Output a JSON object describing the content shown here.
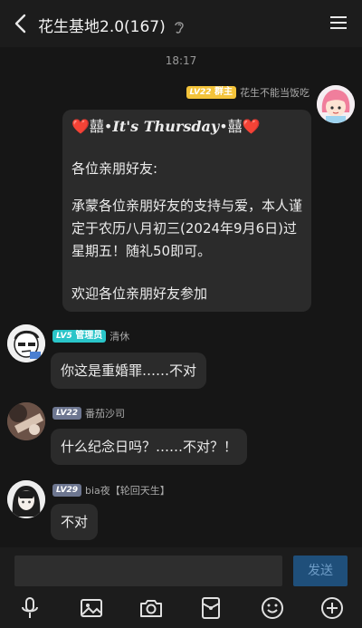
{
  "header": {
    "title": "花生基地2.0(167)"
  },
  "chat": {
    "timestamp": "18:17",
    "messages": [
      {
        "sender": "花生不能当饭吃",
        "level": "LV22",
        "role": "群主",
        "lines": {
          "greeting_pre": "❤️囍•",
          "greeting_mid": "It's Thursday",
          "greeting_post": "•囍❤️",
          "p2": "各位亲朋好友:",
          "p3": "承蒙各位亲朋好友的支持与爱，本人谨定于农历八月初三(2024年9月6日)过星期五！随礼50即可。",
          "p4": "欢迎各位亲朋好友参加"
        }
      },
      {
        "sender": "清休",
        "level": "LV5",
        "role": "管理员",
        "text": "你这是重婚罪……不对"
      },
      {
        "sender": "番茄沙司",
        "level": "LV22",
        "text": "什么纪念日吗？……不对？！"
      },
      {
        "sender": "bia夜【轮回天生】",
        "level": "LV29",
        "text": "不对"
      }
    ]
  },
  "input": {
    "placeholder": "",
    "send_label": "发送"
  },
  "colors": {
    "background": "#161616",
    "bubble": "#2b2b2b",
    "owner_tag": "#f3c33a",
    "admin_tag": "#2ac5c9",
    "send_button": "#1f4f7a"
  }
}
